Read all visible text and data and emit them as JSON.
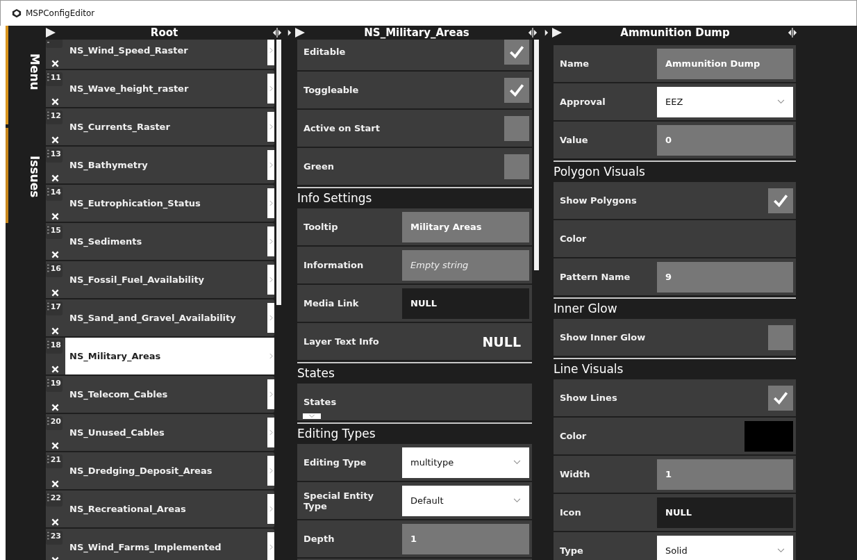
{
  "window": {
    "title": "MSPConfigEditor"
  },
  "side_tabs": [
    {
      "label": "Menu",
      "selected": true
    },
    {
      "label": "Issues",
      "selected": false
    }
  ],
  "tree": {
    "title": "Root",
    "items": [
      {
        "name": "NS_Wind_Speed_Raster",
        "selected": false
      },
      {
        "number": "11",
        "name": "NS_Wave_height_raster",
        "selected": false
      },
      {
        "number": "12",
        "name": "NS_Currents_Raster",
        "selected": false
      },
      {
        "number": "13",
        "name": "NS_Bathymetry",
        "selected": false
      },
      {
        "number": "14",
        "name": "NS_Eutrophication_Status",
        "selected": false
      },
      {
        "number": "15",
        "name": "NS_Sediments",
        "selected": false
      },
      {
        "number": "16",
        "name": "NS_Fossil_Fuel_Availability",
        "selected": false
      },
      {
        "number": "17",
        "name": "NS_Sand_and_Gravel_Availability",
        "selected": false
      },
      {
        "number": "18",
        "name": "NS_Military_Areas",
        "selected": true
      },
      {
        "number": "19",
        "name": "NS_Telecom_Cables",
        "selected": false
      },
      {
        "number": "20",
        "name": "NS_Unused_Cables",
        "selected": false
      },
      {
        "number": "21",
        "name": "NS_Dredging_Deposit_Areas",
        "selected": false
      },
      {
        "number": "22",
        "name": "NS_Recreational_Areas",
        "selected": false
      },
      {
        "number": "23",
        "name": "NS_Wind_Farms_Implemented",
        "selected": false
      }
    ]
  },
  "panels": [
    {
      "title": "NS_Military_Areas",
      "rows": [
        {
          "kind": "checkbox",
          "label": "Editable",
          "checked": true
        },
        {
          "kind": "checkbox",
          "label": "Toggleable",
          "checked": true
        },
        {
          "kind": "checkbox",
          "label": "Active on Start",
          "checked": false
        },
        {
          "kind": "checkbox",
          "label": "Green",
          "checked": false
        },
        {
          "kind": "section",
          "label": "Info Settings"
        },
        {
          "kind": "input",
          "label": "Tooltip",
          "value": "Military Areas"
        },
        {
          "kind": "input",
          "label": "Information",
          "placeholder": "Empty string"
        },
        {
          "kind": "object",
          "label": "Media Link",
          "value": "NULL"
        },
        {
          "kind": "text",
          "label": "Layer Text Info",
          "value": "NULL"
        },
        {
          "kind": "section",
          "label": "States"
        },
        {
          "kind": "list",
          "label": "States"
        },
        {
          "kind": "section",
          "label": "Editing Types"
        },
        {
          "kind": "dropdown",
          "label": "Editing Type",
          "value": "multitype"
        },
        {
          "kind": "dropdown",
          "label": "Special Entity Type",
          "value": "Default"
        },
        {
          "kind": "input",
          "label": "Depth",
          "value": "1"
        }
      ]
    },
    {
      "title": "Ammunition Dump",
      "rows": [
        {
          "kind": "input",
          "label": "Name",
          "value": "Ammunition Dump"
        },
        {
          "kind": "dropdown",
          "label": "Approval",
          "value": "EEZ"
        },
        {
          "kind": "input",
          "label": "Value",
          "value": "0"
        },
        {
          "kind": "section",
          "label": "Polygon Visuals"
        },
        {
          "kind": "checkbox",
          "label": "Show Polygons",
          "checked": true
        },
        {
          "kind": "color",
          "label": "Color"
        },
        {
          "kind": "input",
          "label": "Pattern Name",
          "value": "9"
        },
        {
          "kind": "section",
          "label": "Inner Glow"
        },
        {
          "kind": "checkbox",
          "label": "Show Inner Glow",
          "checked": false
        },
        {
          "kind": "section",
          "label": "Line Visuals"
        },
        {
          "kind": "checkbox",
          "label": "Show Lines",
          "checked": true
        },
        {
          "kind": "color",
          "label": "Color",
          "color": "#000000"
        },
        {
          "kind": "input",
          "label": "Width",
          "value": "1"
        },
        {
          "kind": "object",
          "label": "Icon",
          "value": "NULL"
        },
        {
          "kind": "dropdown",
          "label": "Type",
          "value": "Solid"
        }
      ]
    }
  ]
}
